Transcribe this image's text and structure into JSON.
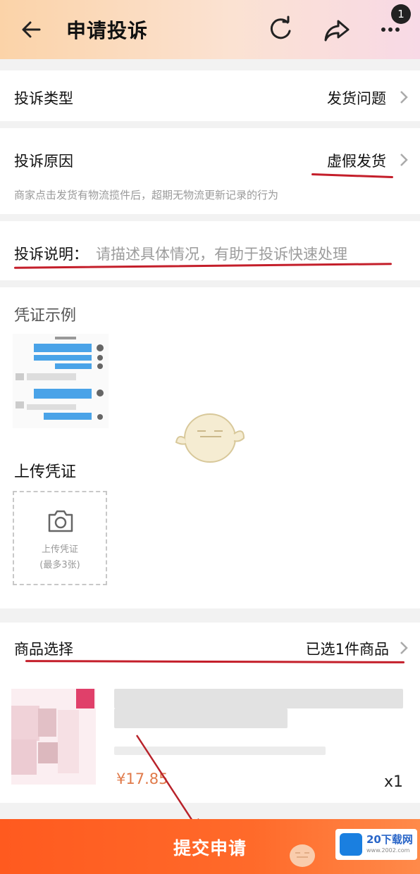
{
  "header": {
    "title": "申请投诉",
    "back_icon": "back-arrow-icon",
    "refresh_icon": "refresh-icon",
    "share_icon": "share-icon",
    "more_icon": "more-icon",
    "badge_count": "1"
  },
  "complaint_type": {
    "label": "投诉类型",
    "value": "发货问题"
  },
  "complaint_reason": {
    "label": "投诉原因",
    "value": "虚假发货",
    "hint": "商家点击发货有物流揽件后，超期无物流更新记录的行为"
  },
  "complaint_desc": {
    "label": "投诉说明：",
    "placeholder": "请描述具体情况，有助于投诉快速处理"
  },
  "evidence": {
    "example_title": "凭证示例",
    "upload_title": "上传凭证",
    "upload_label": "上传凭证",
    "upload_limit": "(最多3张)"
  },
  "product": {
    "label": "商品选择",
    "value": "已选1件商品",
    "price": "¥17.85",
    "qty": "x1"
  },
  "submit": {
    "label": "提交申请"
  },
  "watermark": {
    "name": "20下载网",
    "url": "www.2002.com"
  },
  "colors": {
    "accent": "#ff5a1f",
    "annotation_red": "#c41e2a"
  }
}
